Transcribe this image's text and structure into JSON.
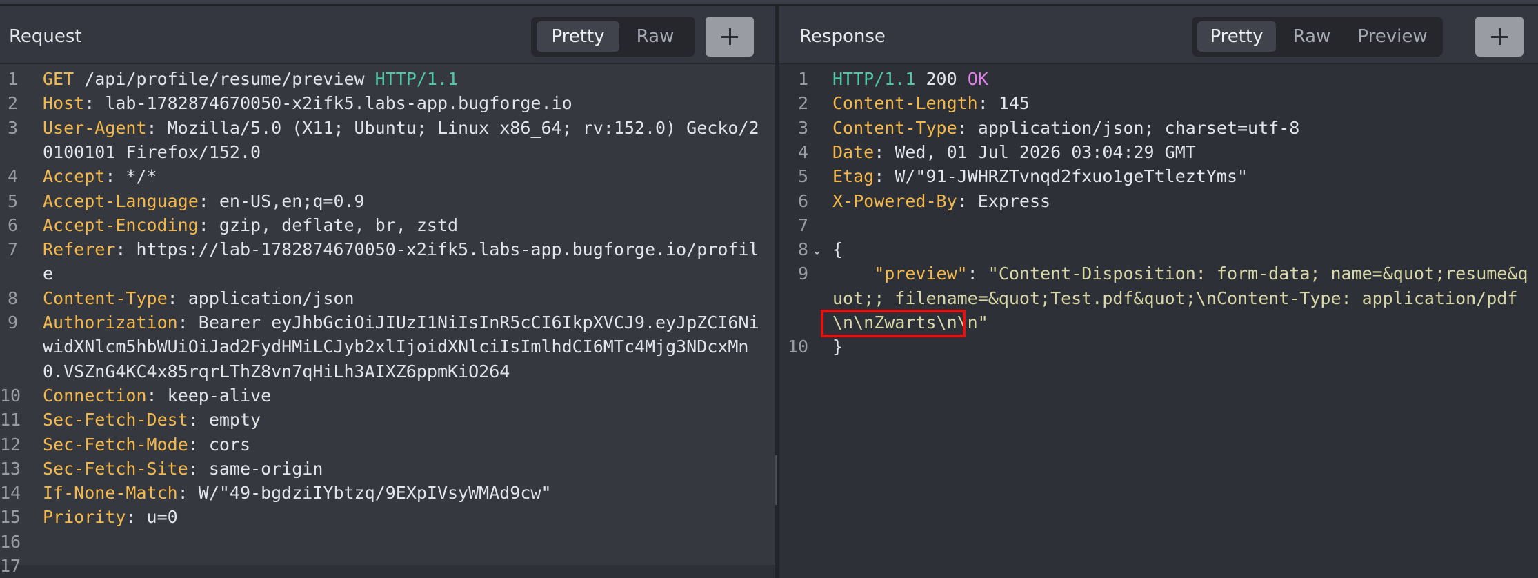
{
  "request": {
    "title": "Request",
    "tabs": [
      "Pretty",
      "Raw"
    ],
    "active_tab": "Pretty",
    "add_label": "+",
    "lines": [
      {
        "n": "1",
        "method": "GET",
        "path": " /api/profile/resume/preview ",
        "proto": "HTTP/1.1"
      },
      {
        "n": "2",
        "key": "Host",
        "val": ": lab-1782874670050-x2ifk5.labs-app.bugforge.io"
      },
      {
        "n": "3",
        "key": "User-Agent",
        "val": ": Mozilla/5.0 (X11; Ubuntu; Linux x86_64; rv:152.0) Gecko/2"
      },
      {
        "n": "",
        "cont": "0100101 Firefox/152.0"
      },
      {
        "n": "4",
        "key": "Accept",
        "val": ": */*"
      },
      {
        "n": "5",
        "key": "Accept-Language",
        "val": ": en-US,en;q=0.9"
      },
      {
        "n": "6",
        "key": "Accept-Encoding",
        "val": ": gzip, deflate, br, zstd"
      },
      {
        "n": "7",
        "key": "Referer",
        "val": ": https://lab-1782874670050-x2ifk5.labs-app.bugforge.io/profil"
      },
      {
        "n": "",
        "cont": "e"
      },
      {
        "n": "8",
        "key": "Content-Type",
        "val": ": application/json"
      },
      {
        "n": "9",
        "key": "Authorization",
        "val": ": Bearer eyJhbGciOiJIUzI1NiIsInR5cCI6IkpXVCJ9.eyJpZCI6Ni"
      },
      {
        "n": "",
        "cont": "widXNlcm5hbWUiOiJad2FydHMiLCJyb2xlIjoidXNlciIsImlhdCI6MTc4Mjg3NDcxMn"
      },
      {
        "n": "",
        "cont": "0.VSZnG4KC4x85rqrLThZ8vn7qHiLh3AIXZ6ppmKiO264"
      },
      {
        "n": "10",
        "key": "Connection",
        "val": ": keep-alive"
      },
      {
        "n": "11",
        "key": "Sec-Fetch-Dest",
        "val": ": empty"
      },
      {
        "n": "12",
        "key": "Sec-Fetch-Mode",
        "val": ": cors"
      },
      {
        "n": "13",
        "key": "Sec-Fetch-Site",
        "val": ": same-origin"
      },
      {
        "n": "14",
        "key": "If-None-Match",
        "val": ": W/\"49-bgdziIYbtzq/9EXpIVsyWMAd9cw\""
      },
      {
        "n": "15",
        "key": "Priority",
        "val": ": u=0"
      },
      {
        "n": "16",
        "cont": ""
      },
      {
        "n": "17",
        "cont": ""
      }
    ]
  },
  "response": {
    "title": "Response",
    "tabs": [
      "Pretty",
      "Raw",
      "Preview"
    ],
    "active_tab": "Pretty",
    "add_label": "+",
    "fold_icon": "chevron-down-icon",
    "lines": [
      {
        "n": "1",
        "status": {
          "proto": "HTTP/1.1",
          "code": " 200 ",
          "text": "OK"
        }
      },
      {
        "n": "2",
        "key": "Content-Length",
        "val": ": 145"
      },
      {
        "n": "3",
        "key": "Content-Type",
        "val": ": application/json; charset=utf-8"
      },
      {
        "n": "4",
        "key": "Date",
        "val": ": Wed, 01 Jul 2026 03:04:29 GMT"
      },
      {
        "n": "5",
        "key": "Etag",
        "val": ": W/\"91-JWHRZTvnqd2fxuo1geTtleztYms\""
      },
      {
        "n": "6",
        "key": "X-Powered-By",
        "val": ": Express"
      },
      {
        "n": "7",
        "cont": ""
      },
      {
        "n": "8",
        "cont": "{",
        "fold": true
      },
      {
        "n": "9",
        "jkey": "    \"preview\"",
        "jsep": ": ",
        "jstr": "\"Content-Disposition: form-data; name=&quot;resume&q"
      },
      {
        "n": "",
        "jstr_cont": "uot;; filename=&quot;Test.pdf&quot;\\nContent-Type: application/pdf"
      },
      {
        "n": "",
        "jstr_cont": "\\n\\nZwarts\\n\\n\"",
        "highlight": true
      },
      {
        "n": "10",
        "cont": "}"
      }
    ]
  },
  "colors": {
    "header_key": "#f2b84b",
    "protocol": "#4fc9a4",
    "status_text": "#e080e8",
    "highlight_box": "#e31313"
  }
}
